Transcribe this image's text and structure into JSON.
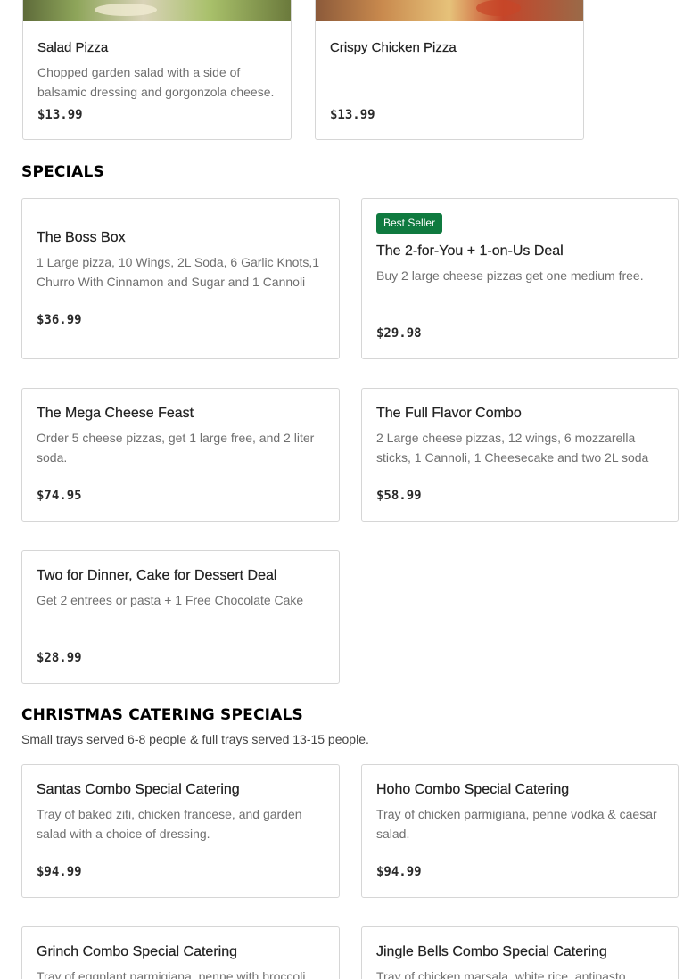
{
  "top_items": [
    {
      "name": "Salad Pizza",
      "description": "Chopped garden salad with a side of balsamic dressing and gorgonzola cheese.",
      "price": "$13.99"
    },
    {
      "name": "Crispy Chicken Pizza",
      "description": "",
      "price": "$13.99"
    }
  ],
  "specials": {
    "heading": "SPECIALS",
    "items": [
      {
        "name": "The Boss Box",
        "description": "1 Large pizza, 10 Wings, 2L Soda, 6 Garlic Knots,1 Churro With Cinnamon and Sugar and 1 Cannoli",
        "price": "$36.99",
        "badge": ""
      },
      {
        "name": "The 2-for-You + 1-on-Us Deal",
        "description": "Buy 2 large cheese pizzas get one medium free.",
        "price": "$29.98",
        "badge": "Best Seller"
      },
      {
        "name": "The Mega Cheese Feast",
        "description": "Order 5 cheese pizzas, get 1 large free, and 2 liter soda.",
        "price": "$74.95",
        "badge": ""
      },
      {
        "name": "The Full Flavor Combo",
        "description": "2 Large cheese pizzas, 12 wings, 6 mozzarella sticks, 1 Cannoli, 1 Cheesecake and two 2L soda",
        "price": "$58.99",
        "badge": ""
      },
      {
        "name": "Two for Dinner, Cake for Dessert Deal",
        "description": "Get 2 entrees or pasta + 1 Free Chocolate Cake",
        "price": "$28.99",
        "badge": ""
      }
    ]
  },
  "christmas": {
    "heading": "CHRISTMAS CATERING SPECIALS",
    "subtitle": "Small trays served 6-8 people & full trays served 13-15 people.",
    "items": [
      {
        "name": "Santas Combo Special Catering",
        "description": "Tray of baked ziti, chicken francese, and garden salad with a choice of dressing.",
        "price": "$94.99"
      },
      {
        "name": "Hoho Combo Special Catering",
        "description": "Tray of chicken parmigiana, penne vodka & caesar salad.",
        "price": "$94.99"
      },
      {
        "name": "Grinch Combo Special Catering",
        "description": "Tray of eggplant parmigiana, penne with broccoli",
        "price": ""
      },
      {
        "name": "Jingle Bells Combo Special Catering",
        "description": "Tray of chicken marsala, white rice, antipasto",
        "price": ""
      }
    ]
  },
  "colors": {
    "badge": "#0f7a3f",
    "border": "#d6d6d6",
    "muted_text": "#6f6f6f"
  }
}
